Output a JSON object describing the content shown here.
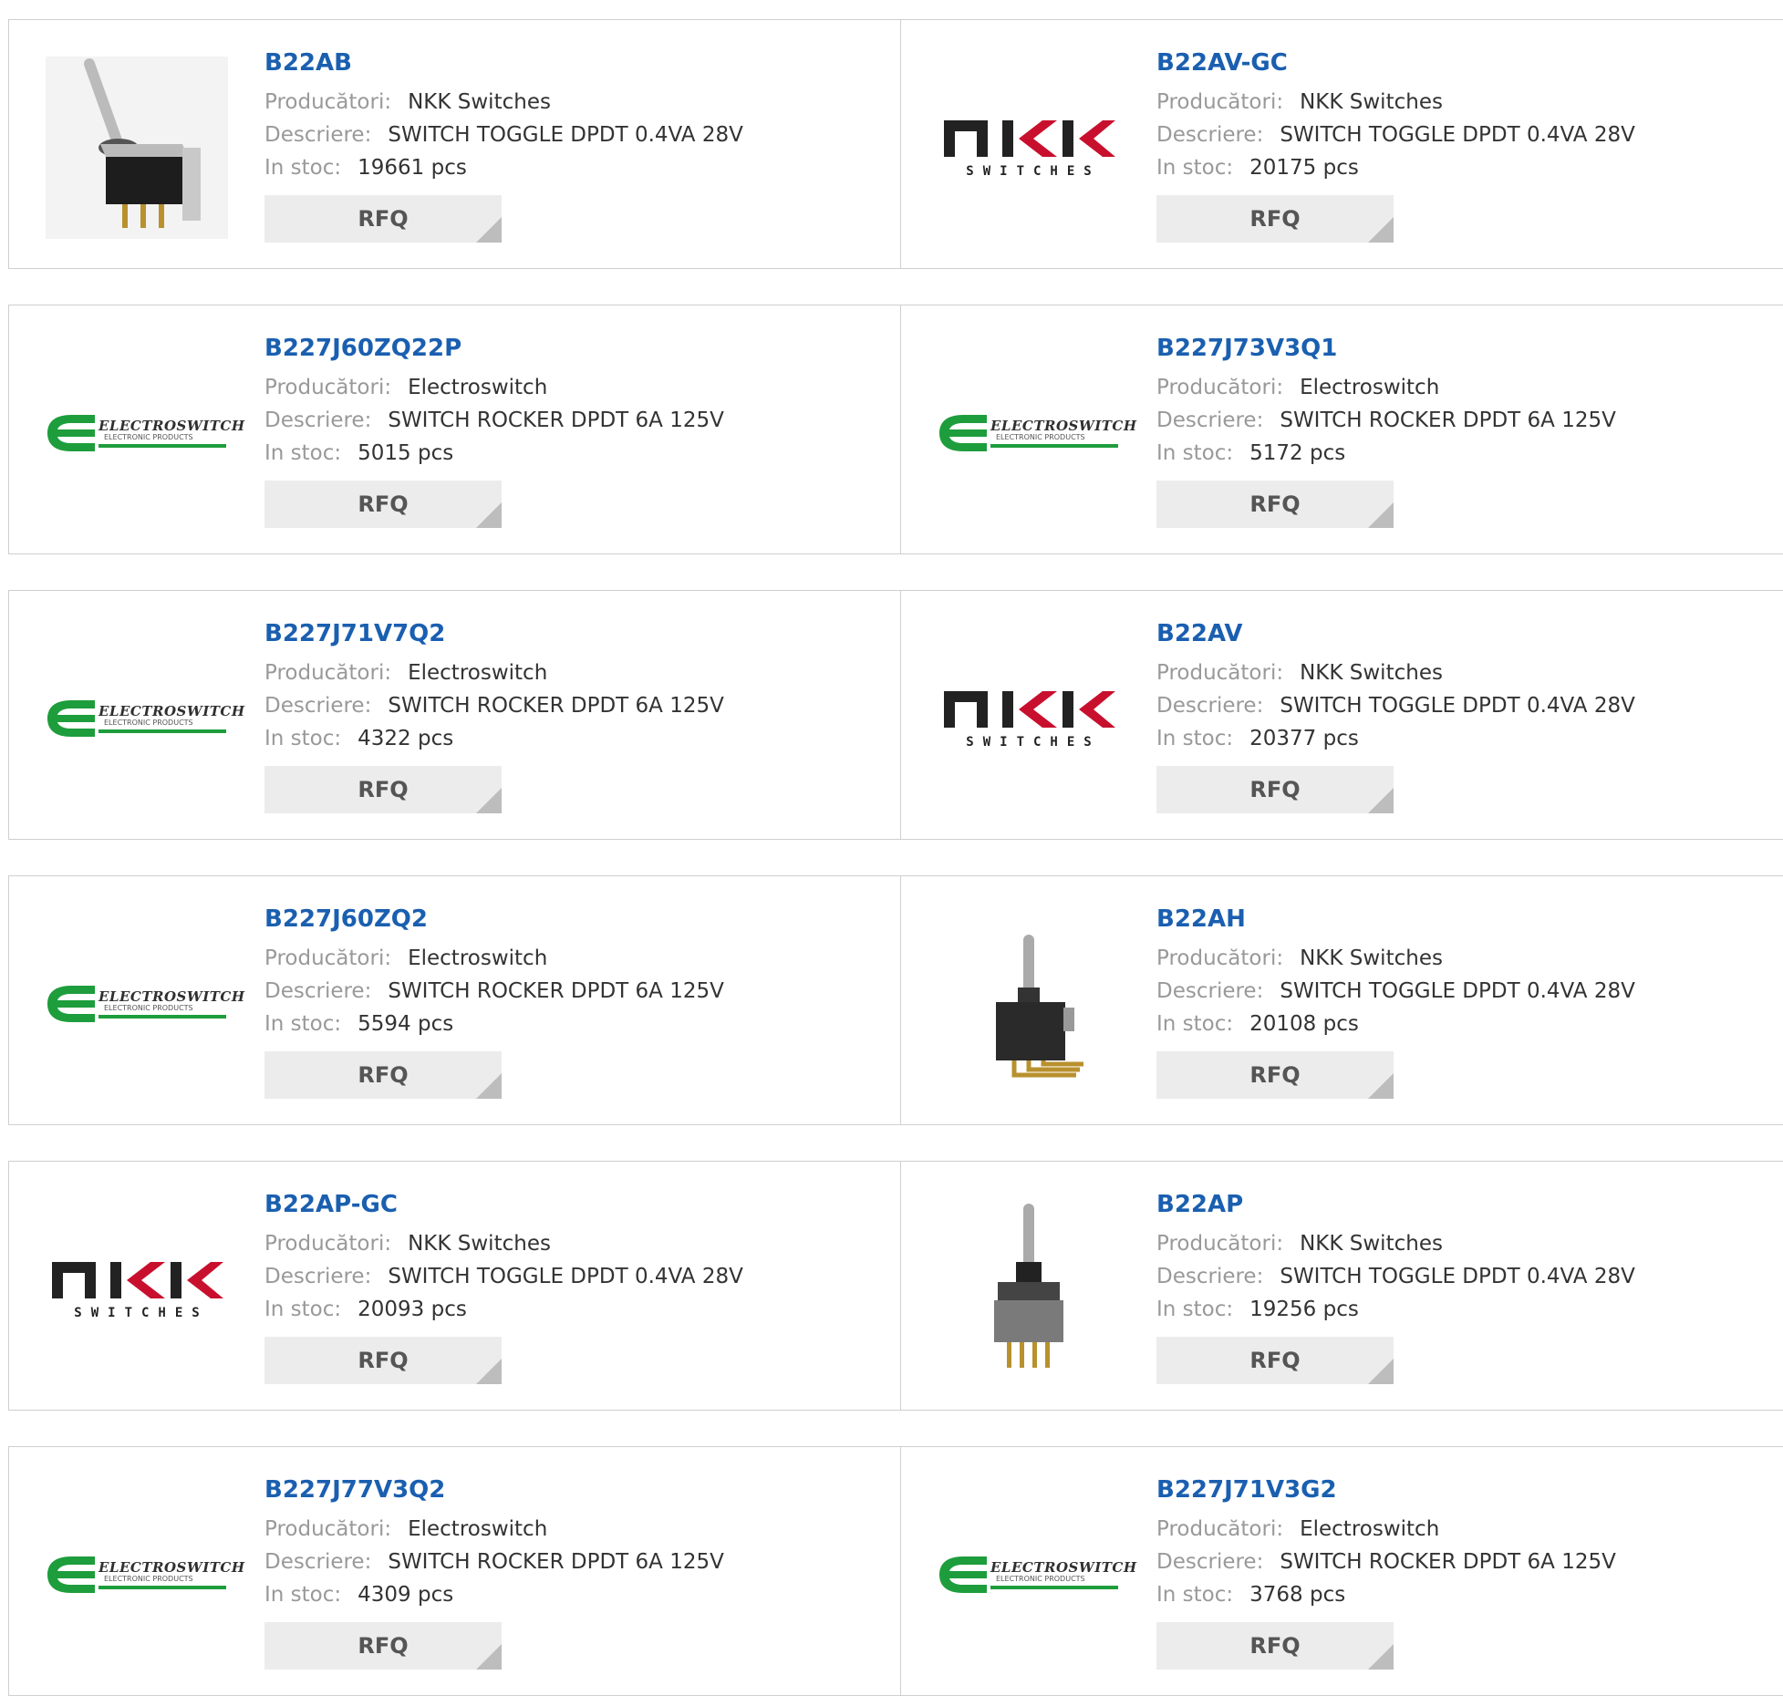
{
  "labels": {
    "manufacturer": "Producători:",
    "description": "Descriere:",
    "stock": "In stoc:",
    "rfq": "RFQ"
  },
  "brand_logos": {
    "nkk": {
      "main": "NKK",
      "sub": "SWITCHES"
    },
    "electroswitch": {
      "main": "ELECTROSWITCH",
      "sub": "ELECTRONIC PRODUCTS"
    }
  },
  "colors": {
    "part_number_link": "#1a5fb0",
    "label_gray": "#999999",
    "electroswitch_green": "#1e9d3c",
    "rfq_button_bg": "#ececec"
  },
  "products": [
    {
      "part_number": "B22AB",
      "manufacturer": "NKK Switches",
      "description": "SWITCH TOGGLE DPDT 0.4VA 28V",
      "stock": "19661 pcs",
      "image": "toggle-switch-photo-right-angle"
    },
    {
      "part_number": "B22AV-GC",
      "manufacturer": "NKK Switches",
      "description": "SWITCH TOGGLE DPDT 0.4VA 28V",
      "stock": "20175 pcs",
      "image": "nkk-logo"
    },
    {
      "part_number": "B227J60ZQ22P",
      "manufacturer": "Electroswitch",
      "description": "SWITCH ROCKER DPDT 6A 125V",
      "stock": "5015 pcs",
      "image": "electroswitch-logo"
    },
    {
      "part_number": "B227J73V3Q1",
      "manufacturer": "Electroswitch",
      "description": "SWITCH ROCKER DPDT 6A 125V",
      "stock": "5172 pcs",
      "image": "electroswitch-logo"
    },
    {
      "part_number": "B227J71V7Q2",
      "manufacturer": "Electroswitch",
      "description": "SWITCH ROCKER DPDT 6A 125V",
      "stock": "4322 pcs",
      "image": "electroswitch-logo"
    },
    {
      "part_number": "B22AV",
      "manufacturer": "NKK Switches",
      "description": "SWITCH TOGGLE DPDT 0.4VA 28V",
      "stock": "20377 pcs",
      "image": "nkk-logo"
    },
    {
      "part_number": "B227J60ZQ2",
      "manufacturer": "Electroswitch",
      "description": "SWITCH ROCKER DPDT 6A 125V",
      "stock": "5594 pcs",
      "image": "electroswitch-logo"
    },
    {
      "part_number": "B22AH",
      "manufacturer": "NKK Switches",
      "description": "SWITCH TOGGLE DPDT 0.4VA 28V",
      "stock": "20108 pcs",
      "image": "toggle-switch-photo-horizontal"
    },
    {
      "part_number": "B22AP-GC",
      "manufacturer": "NKK Switches",
      "description": "SWITCH TOGGLE DPDT 0.4VA 28V",
      "stock": "20093 pcs",
      "image": "nkk-logo"
    },
    {
      "part_number": "B22AP",
      "manufacturer": "NKK Switches",
      "description": "SWITCH TOGGLE DPDT 0.4VA 28V",
      "stock": "19256 pcs",
      "image": "toggle-switch-photo-vertical"
    },
    {
      "part_number": "B227J77V3Q2",
      "manufacturer": "Electroswitch",
      "description": "SWITCH ROCKER DPDT 6A 125V",
      "stock": "4309 pcs",
      "image": "electroswitch-logo"
    },
    {
      "part_number": "B227J71V3G2",
      "manufacturer": "Electroswitch",
      "description": "SWITCH ROCKER DPDT 6A 125V",
      "stock": "3768 pcs",
      "image": "electroswitch-logo"
    }
  ]
}
